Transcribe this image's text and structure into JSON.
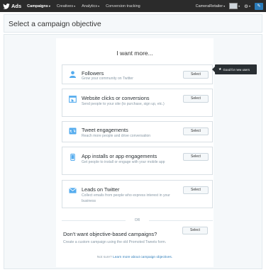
{
  "topbar": {
    "brand": "Ads",
    "nav": [
      {
        "label": "Campaigns",
        "active": true
      },
      {
        "label": "Creatives"
      },
      {
        "label": "Analytics"
      },
      {
        "label": "Conversion tracking"
      }
    ],
    "account_name": "CameraRetailer",
    "caret_glyph": "▾",
    "gear_glyph": "⚙",
    "compose_glyph": "✎"
  },
  "header": {
    "title": "Select a campaign objective"
  },
  "main": {
    "heading": "I want more...",
    "objectives": [
      {
        "title": "Followers",
        "description": "Grow your community on Twitter",
        "select_label": "Select",
        "icon": "person-icon"
      },
      {
        "title": "Website clicks or conversions",
        "description": "Send people to your site (to purchase, sign up, etc.)",
        "select_label": "Select",
        "icon": "website-icon"
      },
      {
        "title": "Tweet engagements",
        "description": "Reach more people and drive conversation",
        "select_label": "Select",
        "icon": "engagement-icon"
      },
      {
        "title": "App installs or app engagements",
        "description": "Get people to install or engage with your mobile app",
        "select_label": "Select",
        "icon": "phone-icon"
      },
      {
        "title": "Leads on Twitter",
        "description": "Collect emails from people who express interest in your business",
        "select_label": "Select",
        "icon": "envelope-icon"
      }
    ],
    "divider_text": "OR",
    "alternative": {
      "title": "Don't want objective-based campaigns?",
      "description": "Create a custom campaign using the old Promoted Tweets form.",
      "select_label": "Select"
    },
    "footnote_prefix": "Not sure?",
    "footnote_link": "Learn more about campaign objectives."
  },
  "tooltip": {
    "star_glyph": "★",
    "text": "Good for new users"
  },
  "colors": {
    "accent": "#2b7bb9",
    "topbar": "#2b2b2b",
    "tooltip": "#292f33"
  }
}
